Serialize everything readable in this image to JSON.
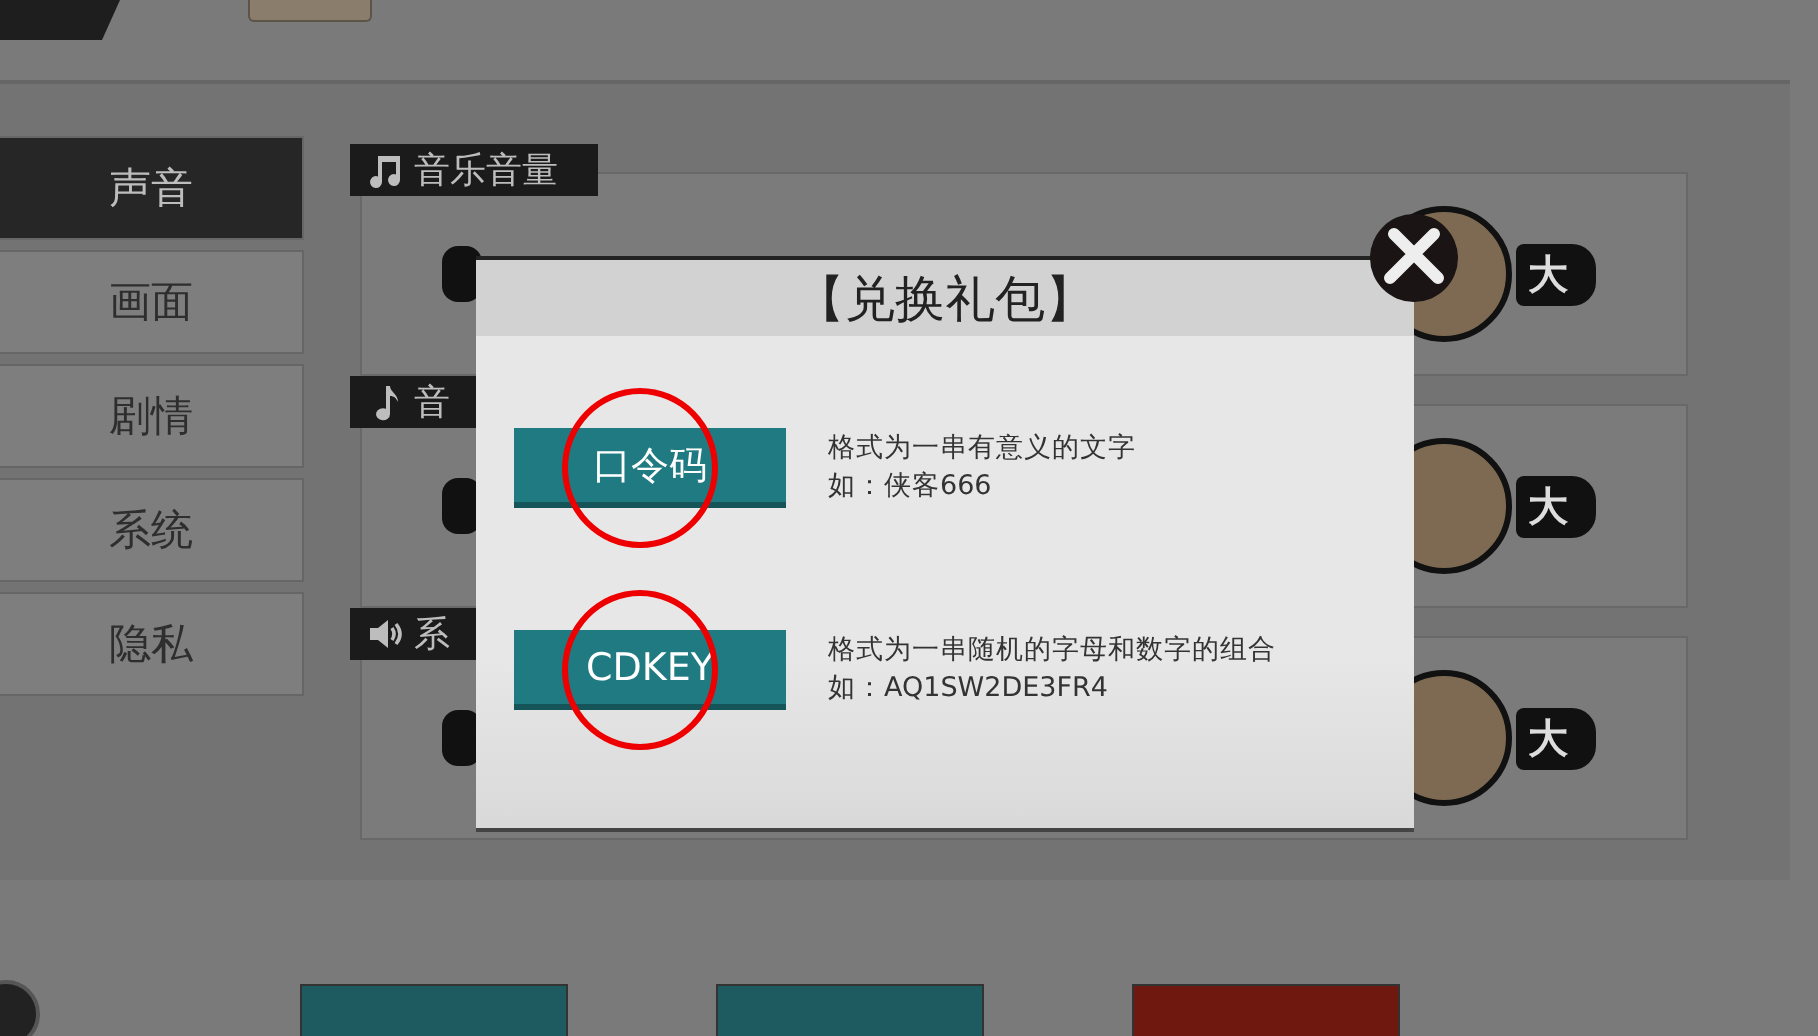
{
  "menu": [
    {
      "label": "声音",
      "selected": true
    },
    {
      "label": "画面",
      "selected": false
    },
    {
      "label": "剧情",
      "selected": false
    },
    {
      "label": "系统",
      "selected": false
    },
    {
      "label": "隐私",
      "selected": false
    }
  ],
  "sliders": [
    {
      "label": "音乐音量",
      "kind": "music",
      "max_label": "大"
    },
    {
      "label": "音",
      "kind": "note",
      "max_label": "大"
    },
    {
      "label": "系",
      "kind": "speaker",
      "max_label": "大"
    }
  ],
  "bottom_buttons": [
    {
      "kind": "teal"
    },
    {
      "kind": "teal"
    },
    {
      "kind": "red"
    }
  ],
  "dialog": {
    "title": "【兑换礼包】",
    "options": [
      {
        "button": "口令码",
        "description": "格式为一串有意义的文字",
        "example": "如：侠客666",
        "highlighted": true
      },
      {
        "button": "CDKEY",
        "description": "格式为一串随机的字母和数字的组合",
        "example": "如：AQ1SW2DE3FR4",
        "highlighted": true
      }
    ]
  }
}
